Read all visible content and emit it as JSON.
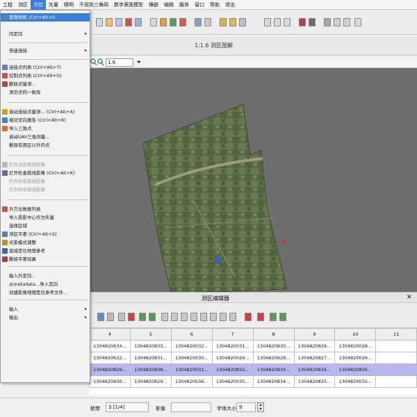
{
  "menubar": [
    "工程",
    "测区",
    "方位",
    "矢量",
    "精明",
    "不规则三角网",
    "数字表面模型",
    "镶嵌",
    "编辑",
    "服务",
    "窗口",
    "帮助",
    "退出"
  ],
  "menubar_active_index": 2,
  "map": {
    "title": "1:1.6 测区图解",
    "zoom_value": "1.6",
    "zoom_arrow": "-▸"
  },
  "dropdown": {
    "items": [
      {
        "label": "管理相机 (Ctrl+Alt+I)",
        "state": "hl",
        "icon": "camera-icon",
        "color": "#5b7fb8"
      },
      {
        "label": "内定向",
        "submenu": true
      },
      {
        "label": "快速连接",
        "submenu": true
      },
      {
        "label": "连接点列表 (Ctrl+Alt+T)",
        "icon": "points-list-icon",
        "color": "#6a7fc0"
      },
      {
        "label": "控制点列表 (Ctrl+Alt+G)",
        "icon": "control-points-icon",
        "color": "#c05a4a"
      },
      {
        "label": "删除点量测...",
        "icon": "delete-points-icon",
        "color": "#b84848"
      },
      {
        "label": "清空点的一致库"
      },
      {
        "label": "自动连接点量测... (Ctrl+Alt+A)",
        "icon": "auto-tie-icon",
        "color": "#d0a020"
      },
      {
        "label": "相对定向报告 (Ctrl+Alt+R)",
        "icon": "report-icon",
        "color": "#4a80c0"
      },
      {
        "label": "导入三角点",
        "icon": "import-triangle-icon",
        "color": "#e07030"
      },
      {
        "label": "自动UAV三角测量..."
      },
      {
        "label": "删除有用区以外的点"
      },
      {
        "label": "打开当前核线影像",
        "state": "dis",
        "icon": "epipolar-icon",
        "color": "#b8b8b8"
      },
      {
        "label": "打开检查核线影像 (Ctrl+Alt+K)",
        "icon": "check-epipolar-icon",
        "color": "#6a6a9a"
      },
      {
        "label": "打开所有核线影像",
        "state": "dis"
      },
      {
        "label": "打开所有核线影像",
        "state": "dis"
      },
      {
        "label": "外方位数据列表",
        "icon": "eo-list-icon",
        "color": "#c05a4a"
      },
      {
        "label": "导入投影中心作为矢量"
      },
      {
        "label": "选择区域"
      },
      {
        "label": "测区平差 (Ctrl+Alt+S)",
        "icon": "adjust-icon",
        "color": "#5a7ab8"
      },
      {
        "label": "光束模式调整",
        "icon": "bundle-icon",
        "color": "#c09030"
      },
      {
        "label": "直接定位地理参考",
        "icon": "georef-icon",
        "color": "#3a6aa8"
      },
      {
        "label": "删除平差结果",
        "icon": "delete-adjust-icon",
        "color": "#a84040"
      },
      {
        "label": "输入外定向..."
      },
      {
        "label": "从metadata...导入定向"
      },
      {
        "label": "创建影像地理定位参考文件..."
      },
      {
        "label": "输入",
        "submenu": true
      },
      {
        "label": "输出",
        "submenu": true
      }
    ]
  },
  "table": {
    "title": "测区编辑器",
    "close_glyph": "✕",
    "columns": [
      "4",
      "5",
      "6",
      "7",
      "8",
      "9",
      "10",
      "11"
    ],
    "rows": [
      {
        "cells": [
          "1304820634...",
          "1304820833...",
          "1304820032...",
          "1304820031...",
          "1304820830...",
          "1304820829...",
          "1304820028...",
          ""
        ],
        "selected": false
      },
      {
        "cells": [
          "1304820632...",
          "1304820831...",
          "1304820030...",
          "1304820029...",
          "1304820828...",
          "1304820827...",
          "1304820026...",
          ""
        ],
        "selected": false
      },
      {
        "cells": [
          "1304820829...",
          "1304820838...",
          "1304820031...",
          "1304820832...",
          "1304820833...",
          "1304820834...",
          "1304820835...",
          ""
        ],
        "selected": true
      },
      {
        "cells": [
          "1304820830...",
          "1304820829...",
          "1304820036...",
          "1304820035...",
          "1304820834...",
          "1304820833...",
          "1304820032...",
          ""
        ],
        "selected": false
      }
    ]
  },
  "status": {
    "label1": "航带",
    "value1": "3 [1/4]",
    "label2": "影像",
    "value2": "",
    "label3": "字体大小",
    "value3": "9"
  },
  "colors": {
    "accent": "#3c7fd9",
    "map_bg": "#6e6e6e",
    "selected_row": "#b9b6f0"
  }
}
